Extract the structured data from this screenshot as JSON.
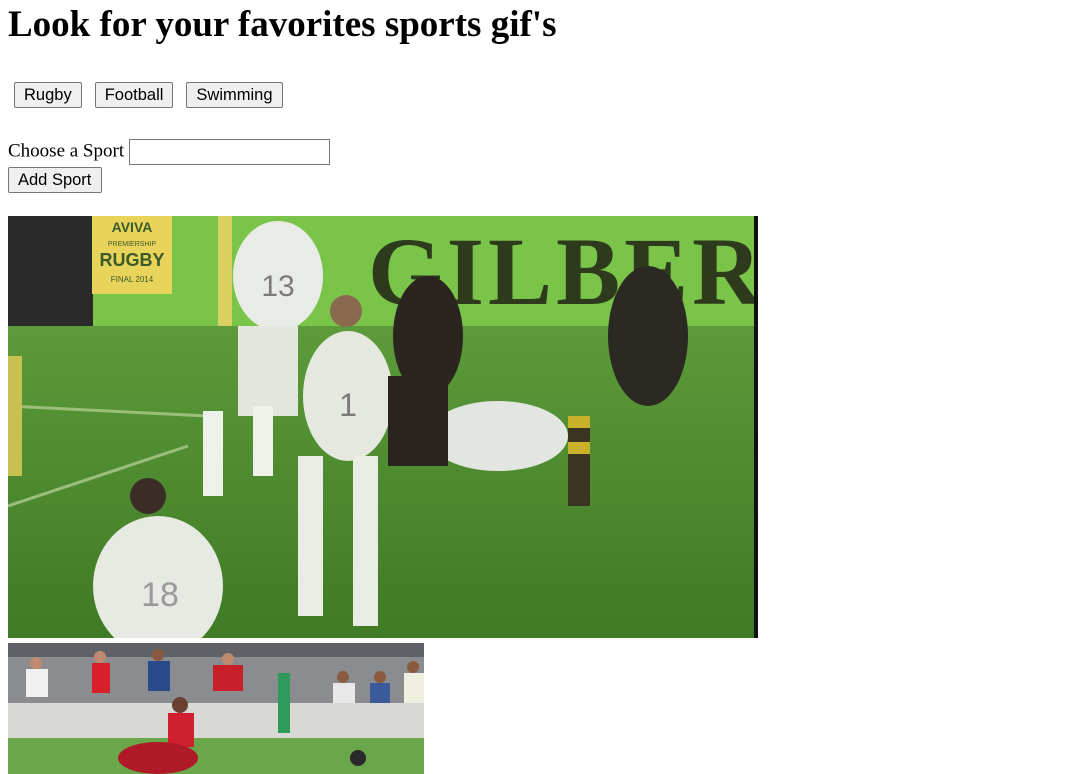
{
  "page": {
    "heading": "Look for your favorites sports gif's"
  },
  "sport_buttons": [
    {
      "label": "Rugby"
    },
    {
      "label": "Football"
    },
    {
      "label": "Swimming"
    }
  ],
  "form": {
    "label": "Choose a Sport",
    "input_value": "",
    "add_label": "Add Sport"
  },
  "gifs": [
    {
      "sign_left": [
        "AVIVA",
        "PREMIERSHIP",
        "RUGBY",
        "FINAL 2014"
      ],
      "banner_text": "GILBERT",
      "jersey_a": "13",
      "jersey_b": "1",
      "jersey_c": "18"
    },
    {}
  ],
  "colors": {
    "pitch_green": "#4f8a2e",
    "banner_green": "#7bc44a",
    "button_bg": "#efefef",
    "button_border": "#767676"
  }
}
